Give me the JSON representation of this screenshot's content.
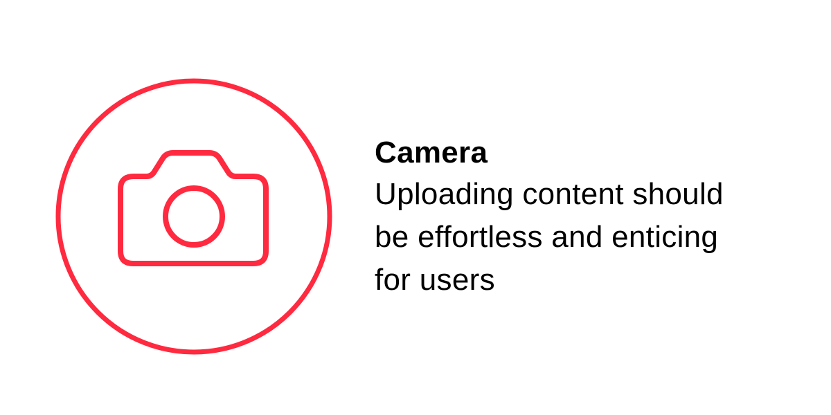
{
  "feature": {
    "icon": "camera-icon",
    "accent_color": "#ff2a3f",
    "title": "Camera",
    "description_lines": [
      "Uploading content should",
      "be effortless and enticing",
      "for users"
    ]
  }
}
